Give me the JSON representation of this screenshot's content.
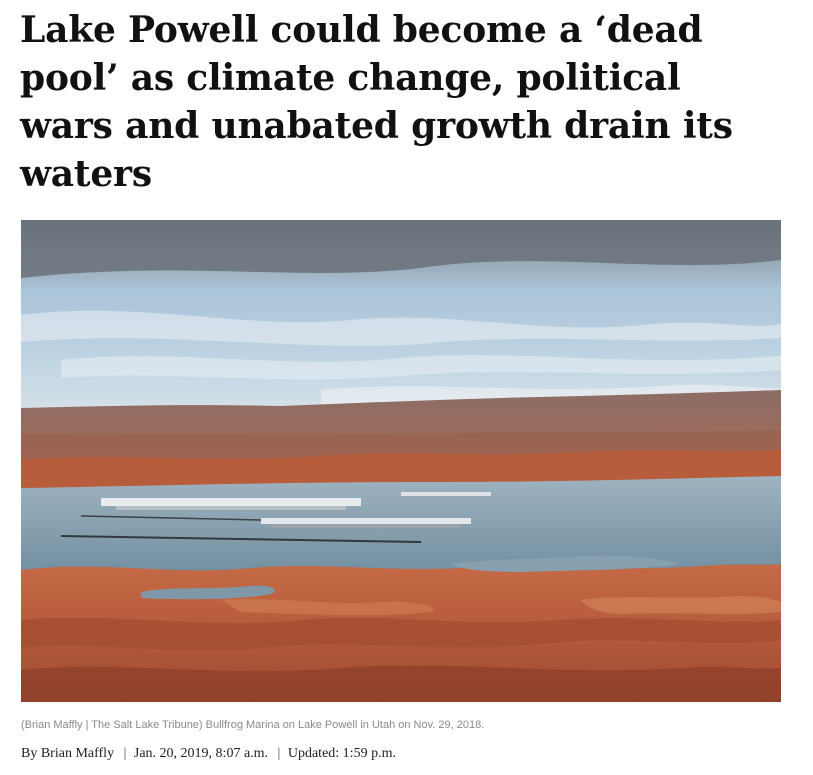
{
  "article": {
    "headline": "Lake Powell could become a ‘dead pool’ as climate change, political wars and unabated growth drain its waters",
    "photo": {
      "subject": "Bullfrog Marina on Lake Powell"
    },
    "caption": {
      "credit": "(Brian Maffly | The Salt Lake Tribune)",
      "text": "Bullfrog Marina on Lake Powell in Utah on Nov. 29, 2018."
    },
    "byline": {
      "author": "By Brian Maffly",
      "date": "Jan. 20, 2019, 8:07 a.m.",
      "updated": "Updated: 1:59 p.m."
    }
  },
  "colors": {
    "headline": "#111111",
    "caption": "#8a8a8a",
    "sky": "#a9c6dc",
    "water": "#6f8fa3",
    "red_rock": "#b4583a"
  }
}
